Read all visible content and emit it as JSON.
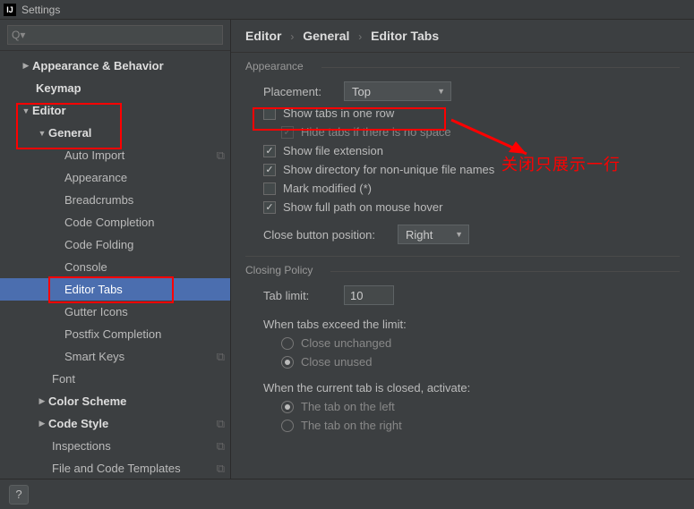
{
  "window": {
    "title": "Settings"
  },
  "search": {
    "placeholder": ""
  },
  "tree": {
    "appearance_behavior": "Appearance & Behavior",
    "keymap": "Keymap",
    "editor": "Editor",
    "general": "General",
    "auto_import": "Auto Import",
    "appearance": "Appearance",
    "breadcrumbs": "Breadcrumbs",
    "code_completion": "Code Completion",
    "code_folding": "Code Folding",
    "console": "Console",
    "editor_tabs": "Editor Tabs",
    "gutter_icons": "Gutter Icons",
    "postfix_completion": "Postfix Completion",
    "smart_keys": "Smart Keys",
    "font": "Font",
    "color_scheme": "Color Scheme",
    "code_style": "Code Style",
    "inspections": "Inspections",
    "file_code_templates": "File and Code Templates"
  },
  "breadcrumb": {
    "seg1": "Editor",
    "seg2": "General",
    "seg3": "Editor Tabs"
  },
  "sections": {
    "appearance": "Appearance",
    "closing_policy": "Closing Policy"
  },
  "appearance": {
    "placement_label": "Placement:",
    "placement_value": "Top",
    "show_tabs_one_row": "Show tabs in one row",
    "hide_tabs_no_space": "Hide tabs if there is no space",
    "show_file_extension": "Show file extension",
    "show_directory_non_unique": "Show directory for non-unique file names",
    "mark_modified": "Mark modified (*)",
    "show_full_path_hover": "Show full path on mouse hover",
    "close_button_position_label": "Close button position:",
    "close_button_position_value": "Right"
  },
  "closing": {
    "tab_limit_label": "Tab limit:",
    "tab_limit_value": "10",
    "when_exceed": "When tabs exceed the limit:",
    "close_unchanged": "Close unchanged",
    "close_unused": "Close unused",
    "when_closed": "When the current tab is closed, activate:",
    "tab_left": "The tab on the left",
    "tab_right": "The tab on the right"
  },
  "annotation": {
    "text": "关闭只展示一行"
  },
  "footer": {
    "help": "?"
  }
}
